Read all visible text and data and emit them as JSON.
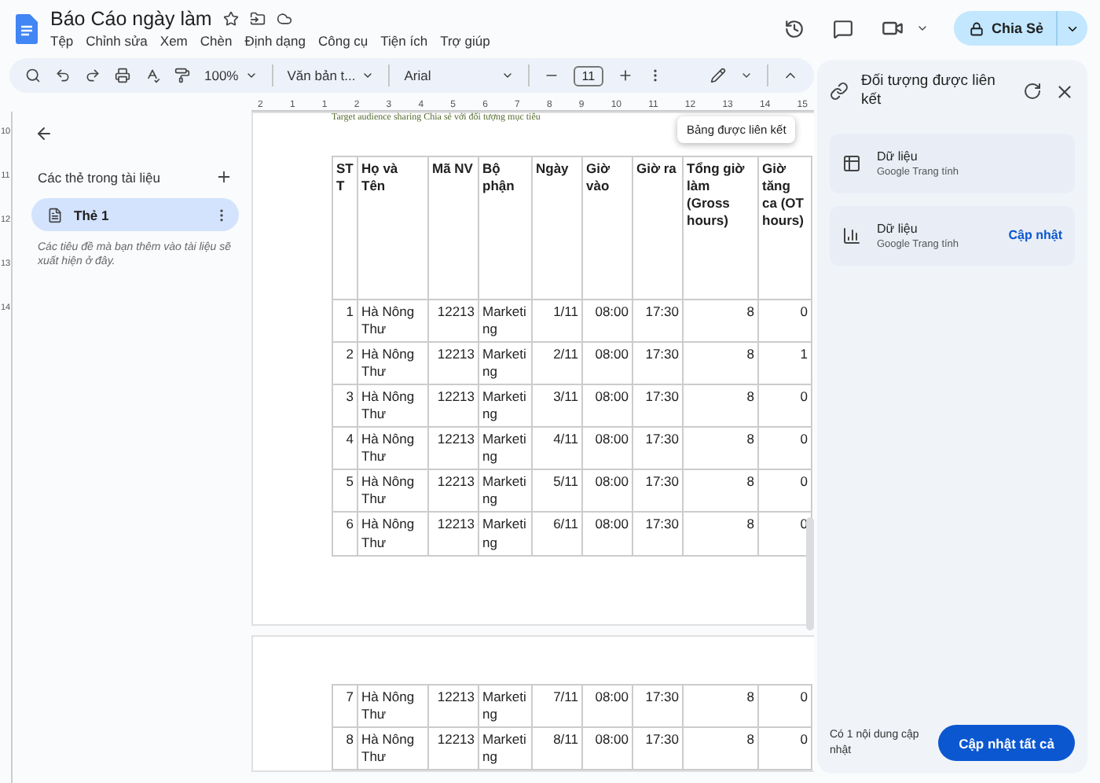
{
  "doc": {
    "title": "Báo Cáo ngày làm"
  },
  "menu": [
    "Tệp",
    "Chỉnh sửa",
    "Xem",
    "Chèn",
    "Định dạng",
    "Công cụ",
    "Tiện ích",
    "Trợ giúp"
  ],
  "toolbar": {
    "zoom": "100%",
    "style": "Văn bản t...",
    "font": "Arial",
    "font_size": "11"
  },
  "share": {
    "label": "Chia Sẻ"
  },
  "ruler": [
    "2",
    "1",
    "1",
    "2",
    "3",
    "4",
    "5",
    "6",
    "7",
    "8",
    "9",
    "10",
    "11",
    "12",
    "13",
    "14",
    "15"
  ],
  "vertical_ruler": [
    "10",
    "11",
    "12",
    "13",
    "14"
  ],
  "outline": {
    "heading": "Các thẻ trong tài liệu",
    "tabs": [
      {
        "label": "Thẻ 1",
        "selected": true
      }
    ],
    "hint": "Các tiêu đề mà bạn thêm vào tài liệu sẽ xuất hiện ở đây."
  },
  "document": {
    "banner": "Target audience sharing Chia sẻ với đối tượng mục tiêu",
    "tooltip": "Bảng được liên kết",
    "columns": [
      "STT",
      "Họ và Tên",
      "Mã NV",
      "Bộ phận",
      "Ngày",
      "Giờ vào",
      "Giờ ra",
      "Tổng giờ làm (Gross hours)",
      "Giờ tăng ca (OT hours)"
    ],
    "pages": [
      {
        "rows": [
          [
            "1",
            "Hà Nông Thư",
            "12213",
            "Marketing",
            "1/11",
            "08:00",
            "17:30",
            "8",
            "0"
          ],
          [
            "2",
            "Hà Nông Thư",
            "12213",
            "Marketing",
            "2/11",
            "08:00",
            "17:30",
            "8",
            "1"
          ],
          [
            "3",
            "Hà Nông Thư",
            "12213",
            "Marketing",
            "3/11",
            "08:00",
            "17:30",
            "8",
            "0"
          ],
          [
            "4",
            "Hà Nông Thư",
            "12213",
            "Marketing",
            "4/11",
            "08:00",
            "17:30",
            "8",
            "0"
          ],
          [
            "5",
            "Hà Nông Thư",
            "12213",
            "Marketing",
            "5/11",
            "08:00",
            "17:30",
            "8",
            "0"
          ],
          [
            "6",
            "Hà Nông Thư",
            "12213",
            "Marketing",
            "6/11",
            "08:00",
            "17:30",
            "8",
            "0"
          ]
        ]
      },
      {
        "rows": [
          [
            "7",
            "Hà Nông Thư",
            "12213",
            "Marketing",
            "7/11",
            "08:00",
            "17:30",
            "8",
            "0"
          ],
          [
            "8",
            "Hà Nông Thư",
            "12213",
            "Marketing",
            "8/11",
            "08:00",
            "17:30",
            "8",
            "0"
          ]
        ]
      }
    ]
  },
  "linked_panel": {
    "title": "Đối tượng được liên kết",
    "items": [
      {
        "kind": "table",
        "name": "Dữ liệu",
        "source": "Google Trang tính"
      },
      {
        "kind": "chart",
        "name": "Dữ liệu",
        "source": "Google Trang tính",
        "action": "Cập nhật"
      }
    ],
    "footer_note": "Có 1 nội dung cập nhật",
    "update_all": "Cập nhật tất cả"
  }
}
